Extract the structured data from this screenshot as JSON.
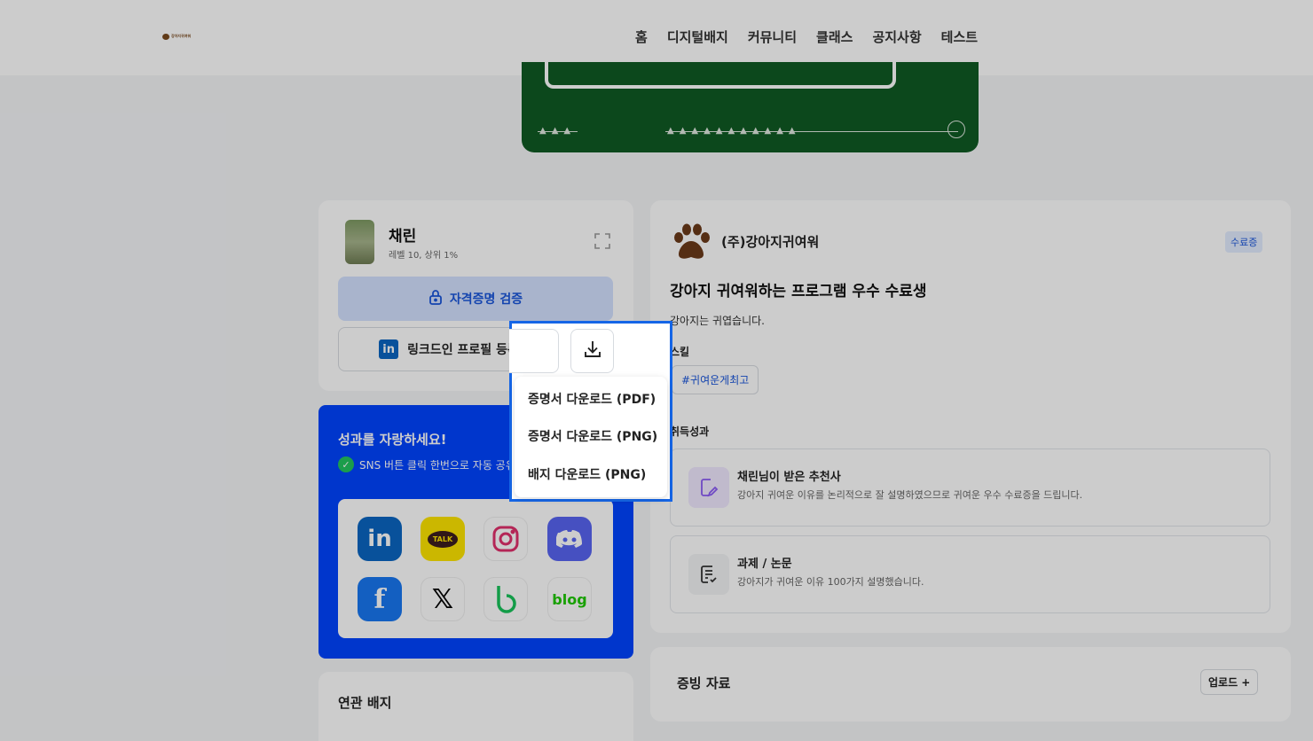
{
  "header": {
    "logo_text": "강아지귀여워",
    "nav": [
      "홈",
      "디지털배지",
      "커뮤니티",
      "클래스",
      "공지사항",
      "테스트"
    ]
  },
  "profile": {
    "name": "채린",
    "level": "레벨 10, 상위 1%",
    "verify_label": "자격증명 검증",
    "linkedin_label": "링크드인 프로필 등록"
  },
  "download_menu": {
    "items": [
      "증명서 다운로드 (PDF)",
      "증명서 다운로드 (PNG)",
      "배지 다운로드 (PNG)"
    ]
  },
  "share": {
    "title": "성과를 자랑하세요!",
    "subtitle": "SNS 버튼 클릭 한번으로 자동 공유",
    "sns": [
      "linkedin",
      "kakaotalk",
      "instagram",
      "discord",
      "facebook",
      "x",
      "band",
      "blog"
    ],
    "kakao_text": "TALK",
    "blog_text": "blog"
  },
  "related": {
    "title": "연관 배지"
  },
  "badge": {
    "org": "(주)강아지귀여워",
    "tag": "수료증",
    "title": "강아지 귀여워하는 프로그램 우수 수료생",
    "description": "강아지는 귀엽습니다.",
    "skills_label": "스킬",
    "skills": [
      "#귀여운게최고"
    ],
    "achievements_label": "취득성과",
    "achievements": [
      {
        "title": "채린님이 받은 추천사",
        "desc": "강아지 귀여운 이유를 논리적으로 잘 설명하였으므로 귀여운 우수 수료증을 드립니다."
      },
      {
        "title": "과제 / 논문",
        "desc": "강아지가 귀여운 이유 100가지 설명했습니다."
      }
    ]
  },
  "evidence": {
    "title": "증빙 자료",
    "upload_label": "업로드 +"
  },
  "colors": {
    "accent": "#1a56db",
    "share_bg": "#0044ff",
    "highlight_border": "#1565e6",
    "cert_green": "#0f5a23"
  }
}
